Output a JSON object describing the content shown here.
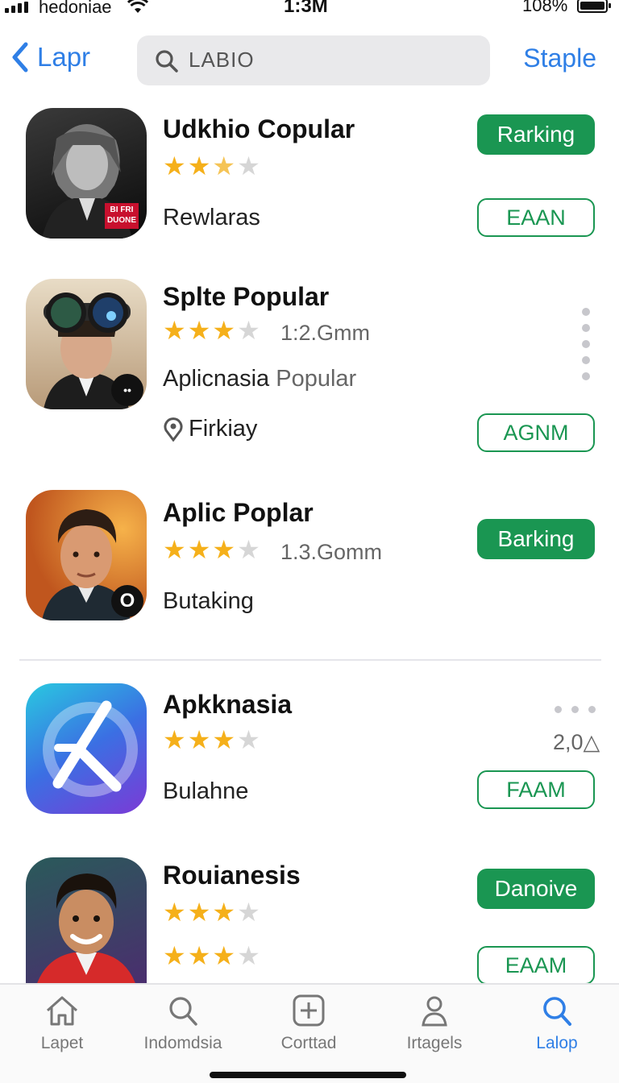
{
  "status_bar": {
    "carrier": "hedoniae",
    "time": "1:3M",
    "battery": "108%"
  },
  "nav": {
    "back_label": "Lapr",
    "search_query": "LABIO",
    "right_action": "Staple"
  },
  "apps": [
    {
      "title": "Udkhio Copular",
      "rating": 2.5,
      "subtitle": "Rewlaras",
      "action_primary": "Rarking",
      "action_secondary": "EAAN",
      "icon_badge": "BI FRI DUONE"
    },
    {
      "title": "Splte Popular",
      "rating": 3,
      "size": "1:2.Gmm",
      "subtitle": "Aplicnasia",
      "subtitle_extra": "Popular",
      "location": "Firkiay",
      "action_secondary": "AGNM"
    },
    {
      "title": "Aplic Poplar",
      "rating": 3,
      "size": "1.3.Gomm",
      "subtitle": "Butaking",
      "action_primary": "Barking",
      "icon_badge": "O"
    },
    {
      "title": "Apkknasia",
      "rating": 3,
      "size": "2,0△",
      "subtitle": "Bulahne",
      "action_secondary": "FAAM"
    },
    {
      "title": "Rouianesis",
      "rating": 3,
      "rating_2": 3,
      "action_primary": "Danoive",
      "action_secondary": "EAAM"
    }
  ],
  "tabs": [
    {
      "label": "Lapet",
      "icon": "home-icon"
    },
    {
      "label": "Indomdsia",
      "icon": "search-icon"
    },
    {
      "label": "Corttad",
      "icon": "plus-square-icon"
    },
    {
      "label": "Irtagels",
      "icon": "person-icon"
    },
    {
      "label": "Lalop",
      "icon": "search-icon",
      "active": true
    }
  ],
  "colors": {
    "accent_blue": "#2f7fe6",
    "action_green": "#1a9652",
    "star": "#f5b01a"
  }
}
